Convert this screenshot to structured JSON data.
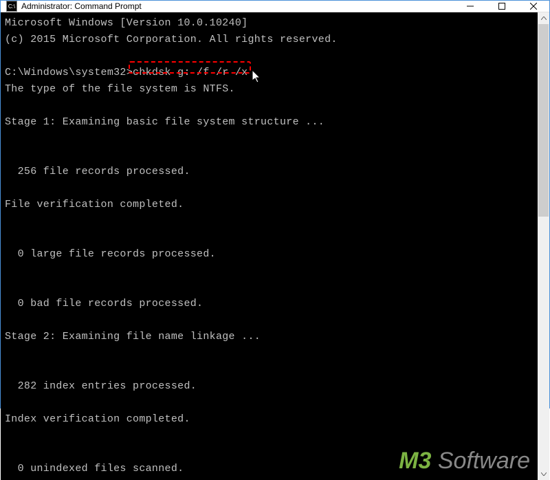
{
  "window": {
    "title": "Administrator: Command Prompt",
    "icon_text": "C:\\"
  },
  "terminal": {
    "lines": [
      "Microsoft Windows [Version 10.0.10240]",
      "(c) 2015 Microsoft Corporation. All rights reserved.",
      "",
      "C:\\Windows\\system32>chkdsk g: /f /r /x",
      "The type of the file system is NTFS.",
      "",
      "Stage 1: Examining basic file system structure ...",
      "",
      "",
      "  256 file records processed.",
      "",
      "File verification completed.",
      "",
      "",
      "  0 large file records processed.",
      "",
      "",
      "  0 bad file records processed.",
      "",
      "Stage 2: Examining file name linkage ...",
      "",
      "",
      "  282 index entries processed.",
      "",
      "Index verification completed.",
      "",
      "",
      "  0 unindexed files scanned."
    ],
    "highlighted_command": "chkdsk g: /f /r /x"
  },
  "watermark": {
    "part1": "M3",
    "part2": " Software"
  }
}
